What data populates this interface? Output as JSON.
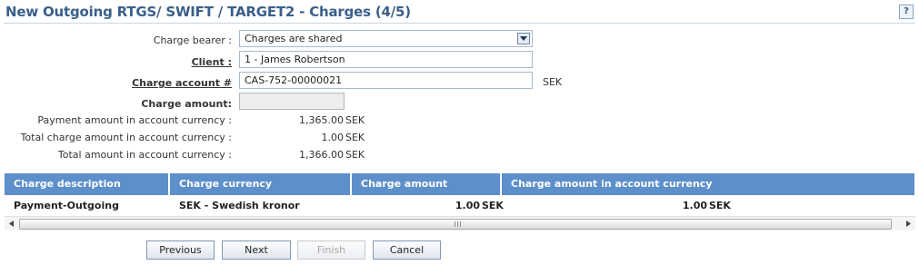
{
  "page": {
    "title": "New Outgoing RTGS/ SWIFT / TARGET2 - Charges (4/5)",
    "help_label": "?"
  },
  "form": {
    "charge_bearer_label": "Charge bearer :",
    "charge_bearer_value": "Charges are shared",
    "client_label": "Client :",
    "client_value": "1 - James Robertson",
    "charge_account_label": "Charge account #",
    "charge_account_value": "CAS-752-00000021",
    "charge_account_currency": "SEK",
    "charge_amount_label": "Charge amount:",
    "charge_amount_value": "",
    "payment_amount_label": "Payment amount in account currency :",
    "payment_amount_value": "1,365.00",
    "payment_amount_currency": "SEK",
    "total_charge_label": "Total charge amount in account currency :",
    "total_charge_value": "1.00",
    "total_charge_currency": "SEK",
    "total_amount_label": "Total amount in account currency :",
    "total_amount_value": "1,366.00",
    "total_amount_currency": "SEK"
  },
  "grid": {
    "columns": [
      "Charge description",
      "Charge currency",
      "Charge amount",
      "Charge amount in account currency"
    ],
    "rows": [
      {
        "description": "Payment-Outgoing",
        "currency": "SEK - Swedish kronor",
        "amount": "1.00",
        "amount_currency": "SEK",
        "account_amount": "1.00",
        "account_currency": "SEK"
      }
    ]
  },
  "buttons": {
    "previous": "Previous",
    "next": "Next",
    "finish": "Finish",
    "cancel": "Cancel"
  },
  "colors": {
    "title": "#3a5f8a",
    "grid_header": "#5d8fca"
  }
}
